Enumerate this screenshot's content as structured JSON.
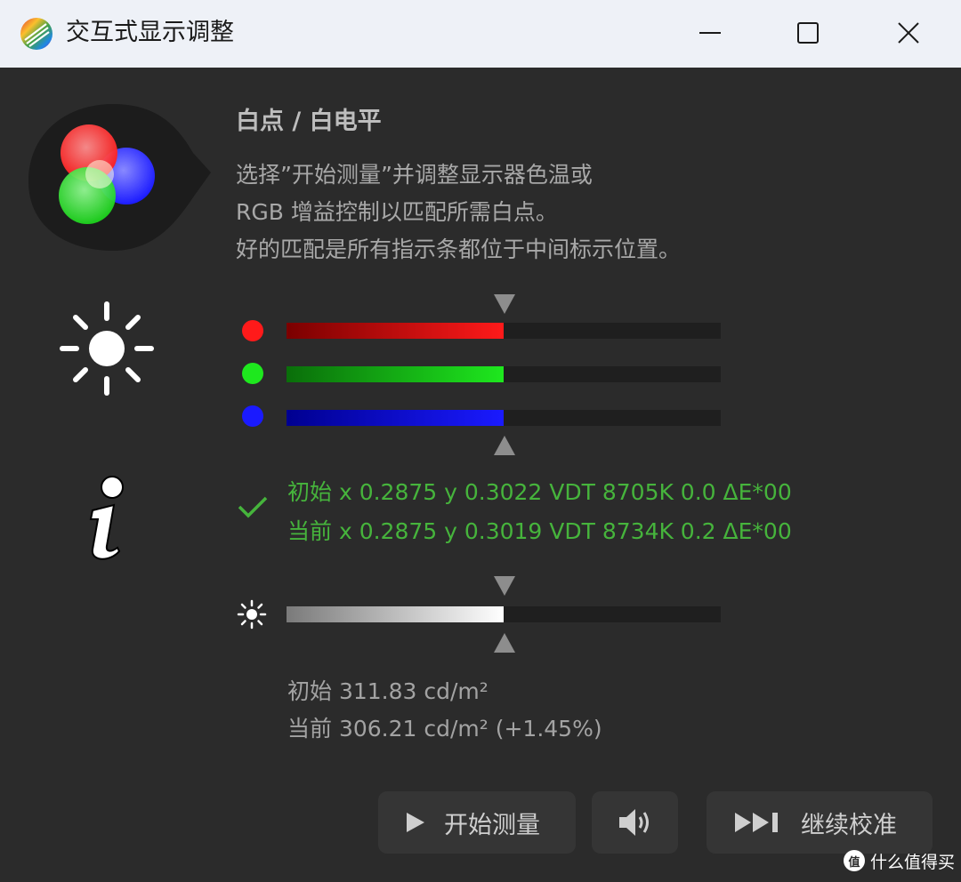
{
  "window": {
    "title": "交互式显示调整"
  },
  "section": {
    "title": "白点 / 白电平",
    "description": [
      "选择”开始测量”并调整显示器色温或",
      "RGB 增益控制以匹配所需白点。",
      "好的匹配是所有指示条都位于中间标示位置。"
    ]
  },
  "bars": {
    "red": {
      "color": "#ff1a1a",
      "level": 0.5
    },
    "green": {
      "color": "#1ee81e",
      "level": 0.5
    },
    "blue": {
      "color": "#1a1aff",
      "level": 0.5
    },
    "luminance": {
      "level": 0.5
    }
  },
  "readouts": {
    "initial": "初始 x 0.2875 y 0.3022 VDT 8705K 0.0 ΔE*00",
    "current": "当前 x 0.2875 y 0.3019 VDT 8734K 0.2 ΔE*00"
  },
  "luminance": {
    "initial": "初始 311.83 cd/m²",
    "current": "当前 306.21 cd/m² (+1.45%)"
  },
  "buttons": {
    "start": "开始测量",
    "continue": "继续校准"
  },
  "watermark": {
    "text": "什么值得买",
    "logo_text": "值"
  },
  "colors": {
    "accent_green": "#46b43c",
    "background": "#2b2b2b",
    "titlebar": "#eef1f7"
  }
}
